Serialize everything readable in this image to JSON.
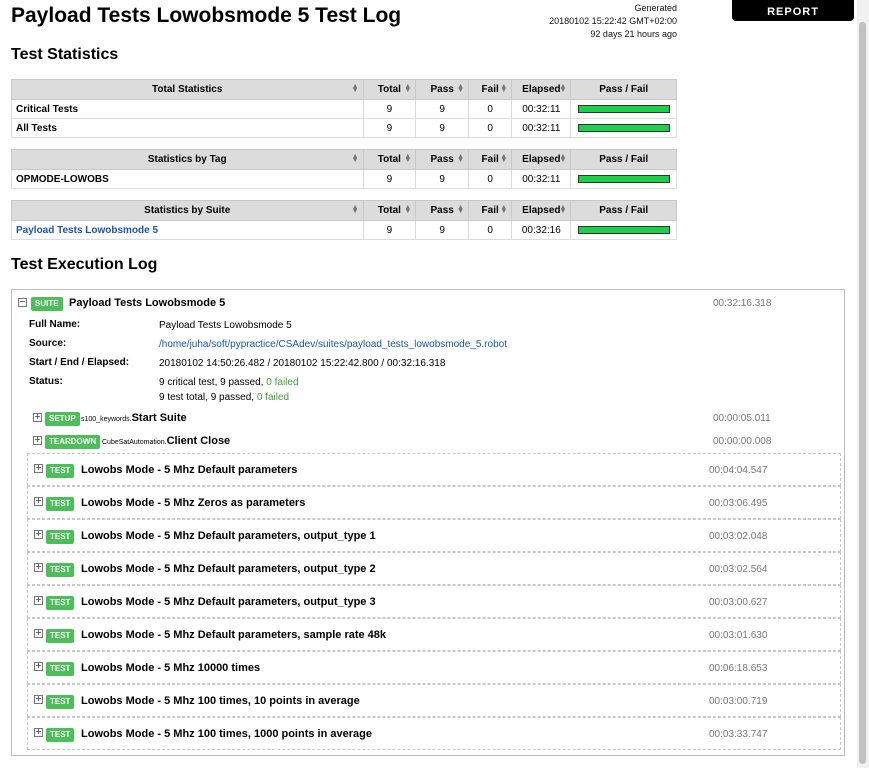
{
  "header": {
    "title": "Payload Tests Lowobsmode 5 Test Log",
    "generated_label": "Generated",
    "generated_time": "20180102 15:22:42 GMT+02:00",
    "generated_ago": "92 days 21 hours ago",
    "report_button": "REPORT"
  },
  "test_statistics": {
    "heading": "Test Statistics",
    "columns": [
      "Total",
      "Pass",
      "Fail",
      "Elapsed",
      "Pass / Fail"
    ],
    "total_table": {
      "header": "Total Statistics",
      "rows": [
        {
          "name": "Critical Tests",
          "total": "9",
          "pass": "9",
          "fail": "0",
          "elapsed": "00:32:11",
          "pass_ratio": 1.0
        },
        {
          "name": "All Tests",
          "total": "9",
          "pass": "9",
          "fail": "0",
          "elapsed": "00:32:11",
          "pass_ratio": 1.0
        }
      ]
    },
    "tag_table": {
      "header": "Statistics by Tag",
      "rows": [
        {
          "name": "OPMODE-LOWOBS",
          "total": "9",
          "pass": "9",
          "fail": "0",
          "elapsed": "00:32:11",
          "pass_ratio": 1.0
        }
      ]
    },
    "suite_table": {
      "header": "Statistics by Suite",
      "rows": [
        {
          "name": "Payload Tests Lowobsmode 5",
          "total": "9",
          "pass": "9",
          "fail": "0",
          "elapsed": "00:32:16",
          "pass_ratio": 1.0
        }
      ]
    }
  },
  "execution_log": {
    "heading": "Test Execution Log",
    "suite": {
      "badge": "SUITE",
      "name": "Payload Tests Lowobsmode 5",
      "elapsed": "00:32:16.318",
      "full_name_label": "Full Name:",
      "full_name": "Payload Tests Lowobsmode 5",
      "source_label": "Source:",
      "source": "/home/juha/soft/pypractice/CSAdev/suites/payload_tests_lowobsmode_5.robot",
      "start_end_label": "Start / End / Elapsed:",
      "start_end": "20180102 14:50:26.482 / 20180102 15:22:42.800 / 00:32:16.318",
      "status_label": "Status:",
      "status_line1_prefix": "9 critical test, 9 passed, ",
      "status_line1_failed": "0 failed",
      "status_line2_prefix": "9 test total, 9 passed, ",
      "status_line2_failed": "0 failed"
    },
    "setup": {
      "badge": "SETUP",
      "library": "s100_keywords.",
      "name": "Start Suite",
      "elapsed": "00:00:05.011"
    },
    "teardown": {
      "badge": "TEARDOWN",
      "library": "CubeSatAutomation.",
      "name": "Client Close",
      "elapsed": "00:00:00.008"
    },
    "tests": [
      {
        "badge": "TEST",
        "name": "Lowobs Mode - 5 Mhz Default parameters",
        "elapsed": "00:04:04.547"
      },
      {
        "badge": "TEST",
        "name": "Lowobs Mode - 5 Mhz Zeros as parameters",
        "elapsed": "00:03:06.495"
      },
      {
        "badge": "TEST",
        "name": "Lowobs Mode - 5 Mhz Default parameters, output_type 1",
        "elapsed": "00:03:02.048"
      },
      {
        "badge": "TEST",
        "name": "Lowobs Mode - 5 Mhz Default parameters, output_type 2",
        "elapsed": "00:03:02.564"
      },
      {
        "badge": "TEST",
        "name": "Lowobs Mode - 5 Mhz Default parameters, output_type 3",
        "elapsed": "00:03:00.627"
      },
      {
        "badge": "TEST",
        "name": "Lowobs Mode - 5 Mhz Default parameters, sample rate 48k",
        "elapsed": "00:03:01.630"
      },
      {
        "badge": "TEST",
        "name": "Lowobs Mode - 5 Mhz 10000 times",
        "elapsed": "00:06:18.653"
      },
      {
        "badge": "TEST",
        "name": "Lowobs Mode - 5 Mhz 100 times, 10 points in average",
        "elapsed": "00:03:00.719"
      },
      {
        "badge": "TEST",
        "name": "Lowobs Mode - 5 Mhz 100 times, 1000 points in average",
        "elapsed": "00:03:33.747"
      }
    ]
  },
  "icons": {
    "expand": "plus-box-icon",
    "collapse": "minus-box-icon",
    "sort": "sort-arrows-icon"
  },
  "colors": {
    "pass_bar": "#1cd14a",
    "badge": "#4bbf58",
    "link": "#1b55b8"
  }
}
